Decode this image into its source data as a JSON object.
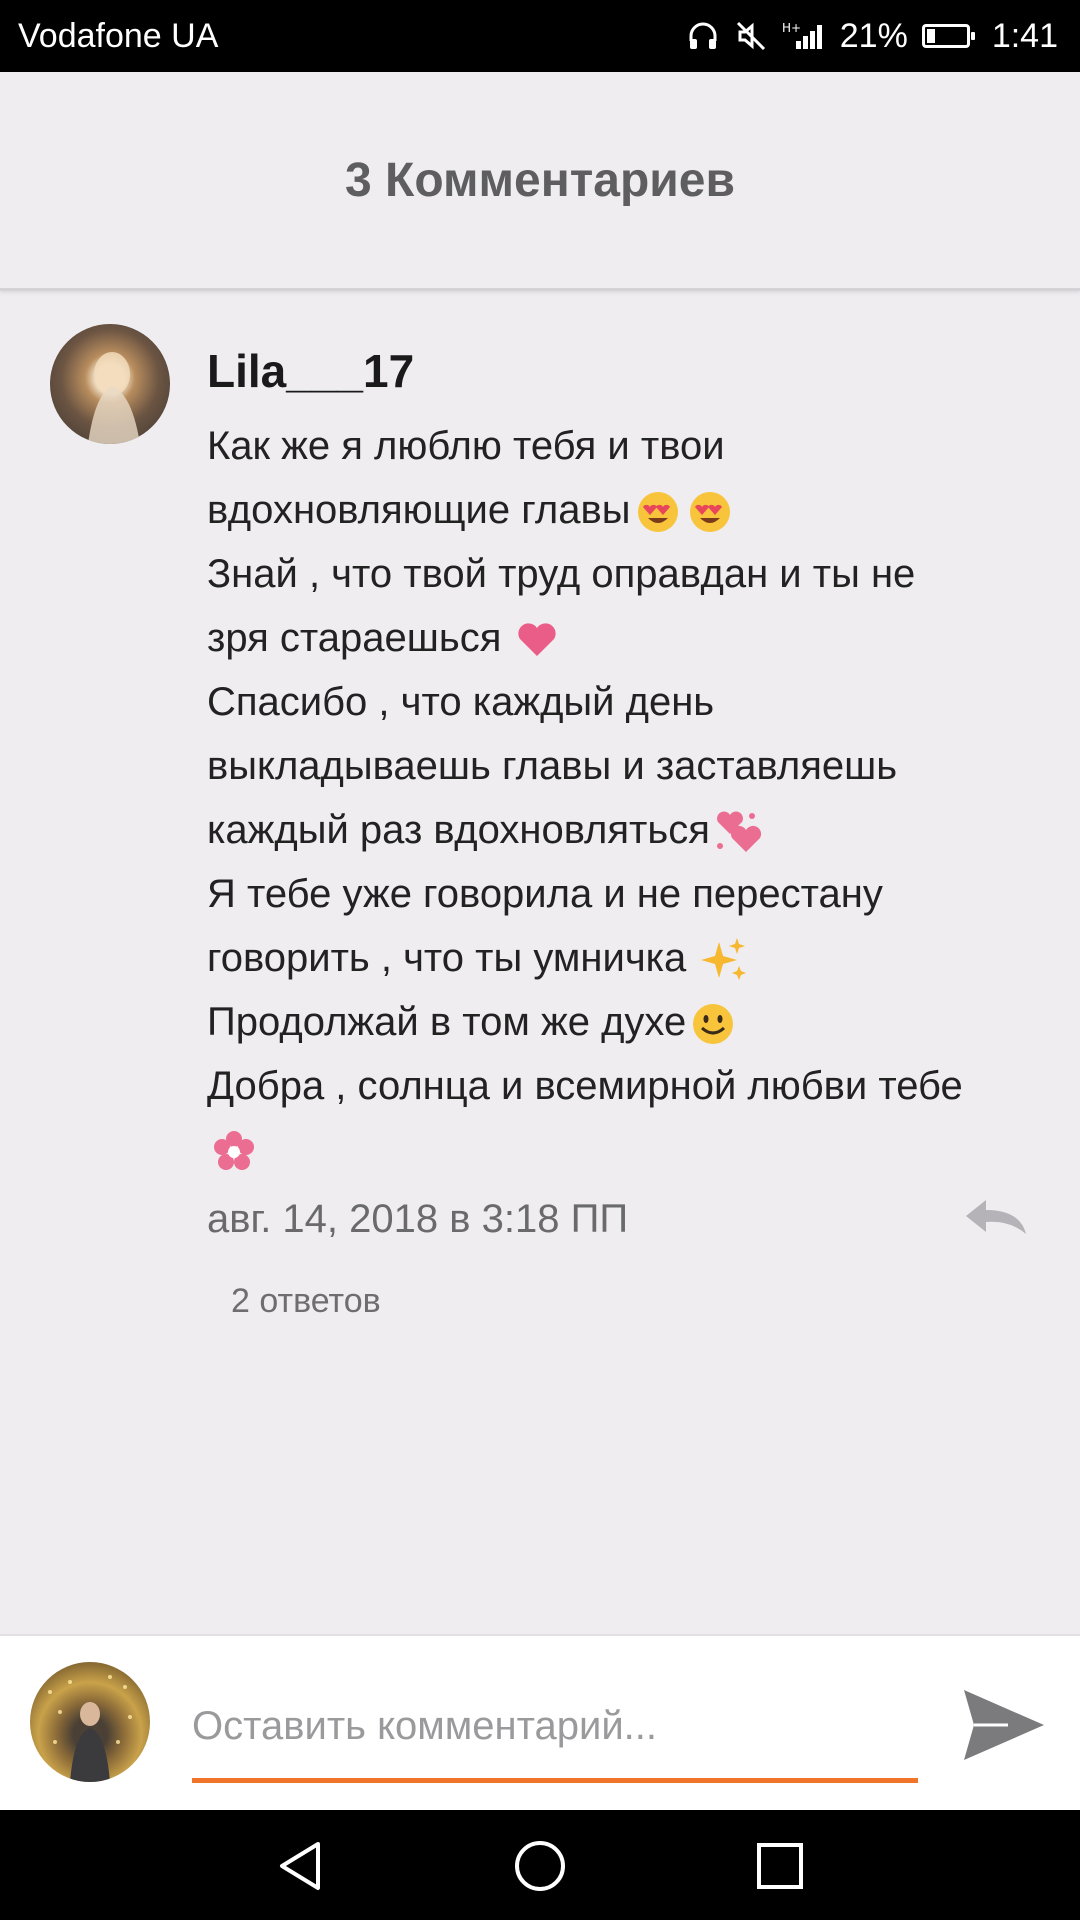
{
  "status_bar": {
    "carrier": "Vodafone UA",
    "network": "H+",
    "battery_percent": "21%",
    "battery_level": 0.21,
    "time": "1:41",
    "icons": [
      "headphones-icon",
      "mute-icon",
      "signal-icon",
      "battery-icon"
    ]
  },
  "header": {
    "title": "3 Комментариев"
  },
  "comment": {
    "username": "Lila___17",
    "lines": [
      "Как же я люблю тебя и твои",
      "вдохновляющие главы",
      "Знай , что твой труд оправдан и ты не",
      "зря стараешься ",
      "Спасибо , что каждый день",
      "выкладываешь главы и заставляешь",
      "каждый раз вдохновляться",
      "Я тебе уже говорила и не перестану",
      "говорить , что ты умничка ",
      "Продолжай в том же духе",
      "Добра , солнца и всемирной любви тебе"
    ],
    "emojis": [
      "heart-eyes-emoji",
      "heart-eyes-emoji",
      "heart-emoji",
      "two-hearts-emoji",
      "sparkles-emoji",
      "smile-emoji",
      "flower-emoji"
    ],
    "timestamp": "авг. 14, 2018 в 3:18 ПП",
    "replies": "2 ответов"
  },
  "composer": {
    "placeholder": "Оставить комментарий..."
  },
  "colors": {
    "accent": "#f0742a",
    "background": "#efedf0",
    "header_text": "#5e5e60"
  }
}
